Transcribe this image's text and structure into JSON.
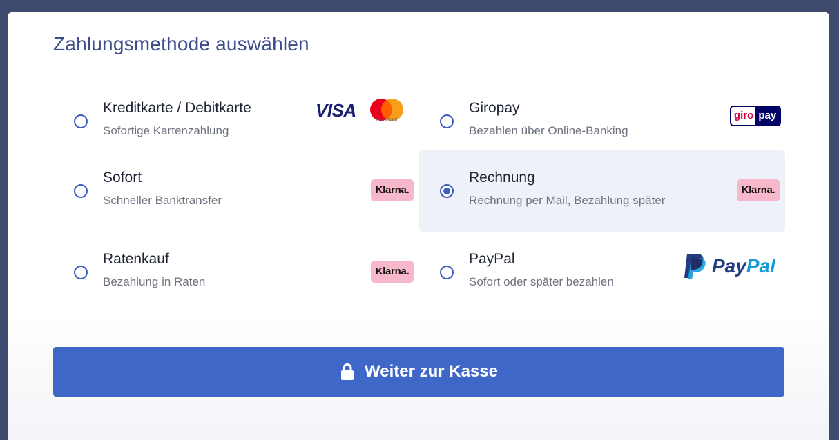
{
  "page": {
    "title": "Zahlungsmethode auswählen"
  },
  "options": [
    {
      "title": "Kreditkarte / Debitkarte",
      "subtitle": "Sofortige Kartenzahlung",
      "selected": false,
      "logo": "visa-mastercard",
      "logo_text": "VISA",
      "logo_subtext": "mastercard"
    },
    {
      "title": "Giropay",
      "subtitle": "Bezahlen über Online-Banking",
      "selected": false,
      "logo": "giropay",
      "logo_text_left": "giro",
      "logo_text_right": "pay"
    },
    {
      "title": "Sofort",
      "subtitle": "Schneller Banktransfer",
      "selected": false,
      "logo": "klarna",
      "logo_text": "Klarna."
    },
    {
      "title": "Rechnung",
      "subtitle": "Rechnung per Mail, Bezahlung später",
      "selected": true,
      "logo": "klarna",
      "logo_text": "Klarna."
    },
    {
      "title": "Ratenkauf",
      "subtitle": "Bezahlung in Raten",
      "selected": false,
      "logo": "klarna",
      "logo_text": "Klarna."
    },
    {
      "title": "PayPal",
      "subtitle": "Sofort oder später bezahlen",
      "selected": false,
      "logo": "paypal",
      "logo_text_dark": "Pay",
      "logo_text_light": "Pal"
    }
  ],
  "checkout_button": {
    "label": "Weiter zur Kasse",
    "icon": "lock-icon"
  },
  "colors": {
    "accent": "#3f67c8",
    "title": "#3d4d8c",
    "selected_bg": "#eef1f7",
    "klarna_pink": "#f8b8cc"
  }
}
